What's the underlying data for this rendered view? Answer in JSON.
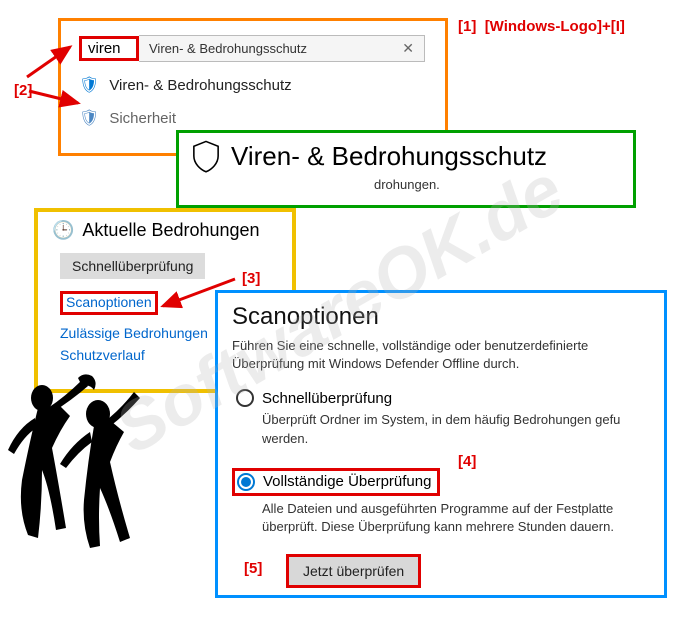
{
  "annotations": {
    "a1": "[1]",
    "a1_text": "[Windows-Logo]+[I]",
    "a2": "[2]",
    "a3": "[3]",
    "a4": "[4]",
    "a5": "[5]"
  },
  "watermark": "SoftwareOK.de",
  "search": {
    "query": "viren",
    "hint": "Viren- & Bedrohungsschutz",
    "close": "✕",
    "result1": "Viren- & Bedrohungsschutz",
    "result2": "Sicherheit"
  },
  "green": {
    "title": "Viren- & Bedrohungsschutz",
    "subtitle_fragment": "drohungen."
  },
  "yellow": {
    "title": "Aktuelle Bedrohungen",
    "quick_button": "Schnellüberprüfung",
    "scan_options": "Scanoptionen",
    "allowed_threats": "Zulässige Bedrohungen",
    "history": "Schutzverlauf"
  },
  "blue": {
    "title": "Scanoptionen",
    "description": "Führen Sie eine schnelle, vollständige oder benutzerdefinierte Überprüfung mit Windows Defender Offline durch.",
    "radio_quick": "Schnellüberprüfung",
    "radio_quick_desc": "Überprüft Ordner im System, in dem häufig Bedrohungen gefu werden.",
    "radio_full": "Vollständige Überprüfung",
    "radio_full_desc": "Alle Dateien und ausgeführten Programme auf der Festplatte überprüft. Diese Überprüfung kann mehrere Stunden dauern.",
    "scan_now": "Jetzt überprüfen"
  }
}
